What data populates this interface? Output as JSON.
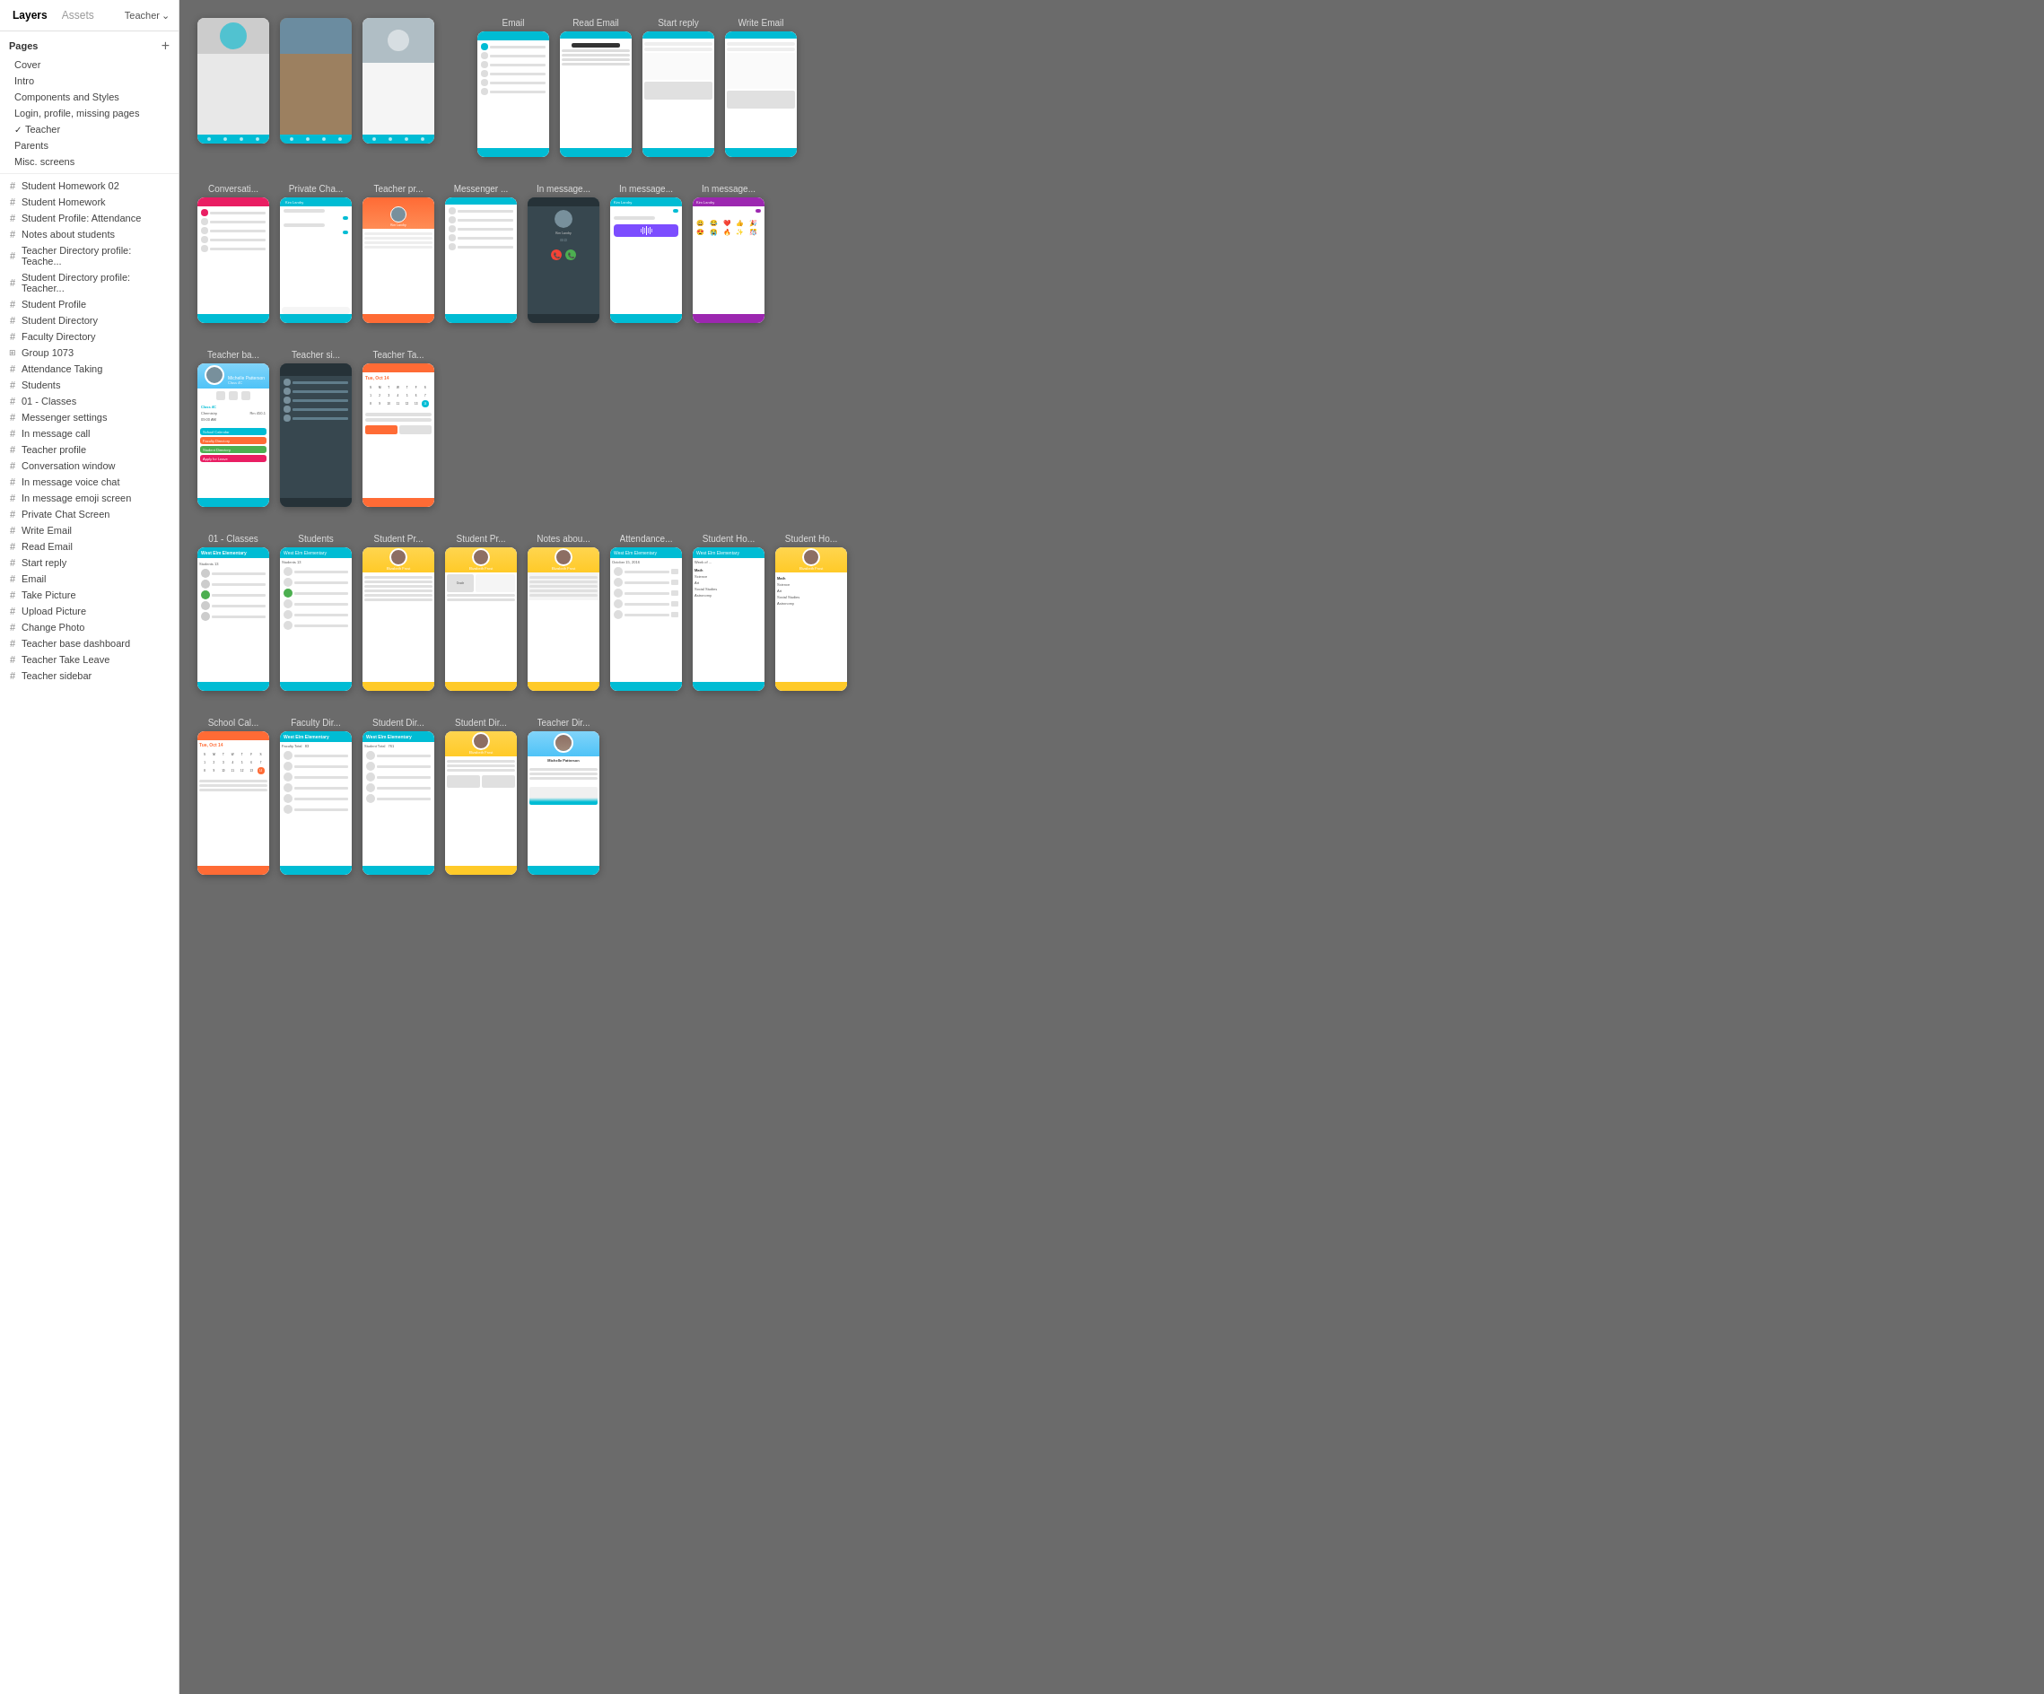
{
  "sidebar": {
    "tabs": [
      {
        "id": "layers",
        "label": "Layers",
        "active": true
      },
      {
        "id": "assets",
        "label": "Assets",
        "active": false
      }
    ],
    "user_label": "Teacher",
    "pages_section": {
      "title": "Pages",
      "add_button_label": "+",
      "pages": [
        {
          "id": "cover",
          "label": "Cover",
          "active": false
        },
        {
          "id": "intro",
          "label": "Intro",
          "active": false
        },
        {
          "id": "components",
          "label": "Components and Styles",
          "active": false
        },
        {
          "id": "login",
          "label": "Login, profile, missing pages",
          "active": false
        },
        {
          "id": "teacher",
          "label": "Teacher",
          "active": true,
          "checked": true
        },
        {
          "id": "parents",
          "label": "Parents",
          "active": false
        },
        {
          "id": "misc",
          "label": "Misc. screens",
          "active": false
        }
      ]
    },
    "layers": [
      {
        "id": "student-hw-02",
        "label": "Student Homework 02",
        "icon": "hash"
      },
      {
        "id": "student-hw",
        "label": "Student Homework",
        "icon": "hash"
      },
      {
        "id": "student-profile-attendance",
        "label": "Student Profile: Attendance",
        "icon": "hash"
      },
      {
        "id": "notes-students",
        "label": "Notes about students",
        "icon": "hash"
      },
      {
        "id": "teacher-dir-profile-teache",
        "label": "Teacher Directory profile: Teache...",
        "icon": "hash"
      },
      {
        "id": "student-dir-profile-teacher",
        "label": "Student Directory profile: Teacher...",
        "icon": "hash"
      },
      {
        "id": "student-profile",
        "label": "Student Profile",
        "icon": "hash"
      },
      {
        "id": "student-directory",
        "label": "Student Directory",
        "icon": "hash"
      },
      {
        "id": "faculty-directory",
        "label": "Faculty Directory",
        "icon": "hash"
      },
      {
        "id": "group-1073",
        "label": "Group 1073",
        "icon": "group"
      },
      {
        "id": "attendance-taking",
        "label": "Attendance Taking",
        "icon": "hash"
      },
      {
        "id": "students",
        "label": "Students",
        "icon": "hash"
      },
      {
        "id": "01-classes",
        "label": "01 - Classes",
        "icon": "hash"
      },
      {
        "id": "messenger-settings",
        "label": "Messenger settings",
        "icon": "hash"
      },
      {
        "id": "in-message-call",
        "label": "In message call",
        "icon": "hash"
      },
      {
        "id": "teacher-profile",
        "label": "Teacher profile",
        "icon": "hash"
      },
      {
        "id": "conversation-window",
        "label": "Conversation window",
        "icon": "hash"
      },
      {
        "id": "in-message-voice-chat",
        "label": "In message voice chat",
        "icon": "hash"
      },
      {
        "id": "in-message-emoji",
        "label": "In message emoji screen",
        "icon": "hash"
      },
      {
        "id": "private-chat-screen",
        "label": "Private Chat Screen",
        "icon": "hash"
      },
      {
        "id": "write-email",
        "label": "Write Email",
        "icon": "hash"
      },
      {
        "id": "read-email",
        "label": "Read Email",
        "icon": "hash"
      },
      {
        "id": "start-reply",
        "label": "Start reply",
        "icon": "hash"
      },
      {
        "id": "email",
        "label": "Email",
        "icon": "hash"
      },
      {
        "id": "take-picture",
        "label": "Take Picture",
        "icon": "hash"
      },
      {
        "id": "upload-picture",
        "label": "Upload Picture",
        "icon": "hash"
      },
      {
        "id": "change-photo",
        "label": "Change Photo",
        "icon": "hash"
      },
      {
        "id": "teacher-base-dashboard",
        "label": "Teacher base dashboard",
        "icon": "hash"
      },
      {
        "id": "teacher-take-leave",
        "label": "Teacher Take Leave",
        "icon": "hash"
      },
      {
        "id": "teacher-sidebar",
        "label": "Teacher sidebar",
        "icon": "hash"
      }
    ]
  },
  "canvas": {
    "rows": [
      {
        "id": "row-top",
        "frames": [
          {
            "id": "photo-frames",
            "labels": [
              "",
              "",
              ""
            ],
            "type": "photo-upload"
          },
          {
            "id": "email-frames",
            "labels": [
              "Email",
              "Read Email",
              "Start reply",
              "Write Email"
            ],
            "type": "email"
          }
        ]
      },
      {
        "id": "row-messaging",
        "labels": [
          "Conversati...",
          "Private Cha...",
          "Teacher pr...",
          "Messenger ...",
          "In message...",
          "In message...",
          "In message..."
        ],
        "type": "messaging"
      },
      {
        "id": "row-classes",
        "labels": [
          "01 - Classes",
          "Students",
          "Student Pr...",
          "Student Pr...",
          "Notes abou...",
          "Attendance...",
          "Student Ho...",
          "Student Ho..."
        ],
        "type": "classes"
      },
      {
        "id": "row-teacher-frames",
        "labels": [
          "Teacher ba...",
          "Teacher si...",
          "Teacher Ta..."
        ],
        "type": "teacher-frames"
      },
      {
        "id": "row-directories",
        "labels": [
          "School Cal...",
          "Faculty Dir...",
          "Student Dir...",
          "Student Dir...",
          "Teacher Dir..."
        ],
        "type": "directories"
      }
    ]
  }
}
